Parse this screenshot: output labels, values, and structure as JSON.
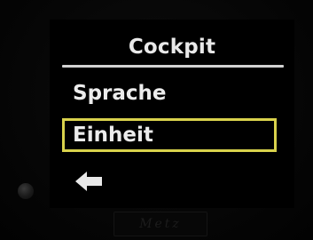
{
  "screen": {
    "title": "Cockpit",
    "menu": [
      {
        "label": "Sprache",
        "selected": false
      },
      {
        "label": "Einheit",
        "selected": true
      }
    ],
    "back_icon": "left-arrow-icon",
    "highlight_color": "#d9d24c"
  },
  "device": {
    "brand_logo": "Metz"
  }
}
